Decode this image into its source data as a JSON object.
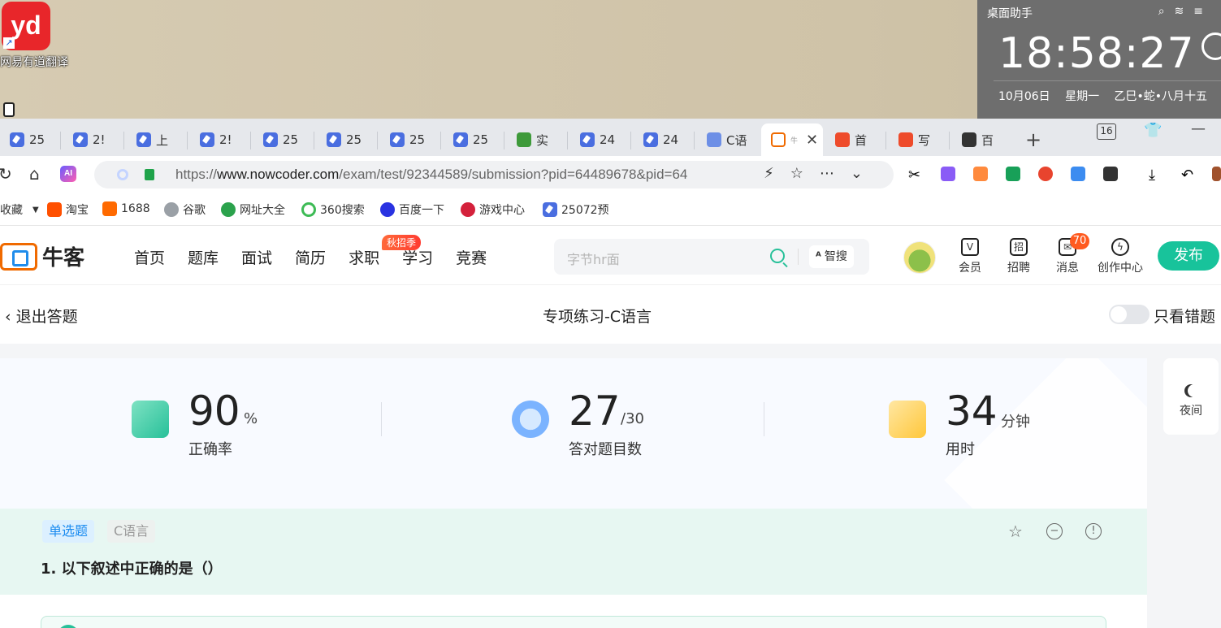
{
  "desktop": {
    "app_icon_text": "yd",
    "app_icon_label": "网易有道翻译",
    "widget": {
      "title": "桌面助手",
      "time": "18:58:27",
      "date": "10月06日",
      "weekday": "星期一",
      "lunar": "乙巳•蛇•八月十五"
    }
  },
  "browser": {
    "tabs": [
      {
        "label": "25",
        "icon": "pen-icon"
      },
      {
        "label": "2!",
        "icon": "pen-icon"
      },
      {
        "label": "上",
        "icon": "pen-icon"
      },
      {
        "label": "2!",
        "icon": "pen-icon"
      },
      {
        "label": "25",
        "icon": "pen-icon"
      },
      {
        "label": "25",
        "icon": "pen-icon"
      },
      {
        "label": "25",
        "icon": "pen-icon"
      },
      {
        "label": "25",
        "icon": "pen-icon"
      },
      {
        "label": "实",
        "icon": "green-icon"
      },
      {
        "label": "24",
        "icon": "pen-icon"
      },
      {
        "label": "24",
        "icon": "pen-icon"
      },
      {
        "label": "C语",
        "icon": "bird-icon"
      },
      {
        "label": "牛",
        "icon": "nowcoder-icon",
        "active": true
      },
      {
        "label": "首",
        "icon": "csdn-icon"
      },
      {
        "label": "写",
        "icon": "csdn-icon"
      },
      {
        "label": "百",
        "icon": "owl-icon"
      }
    ],
    "tab_count": "16",
    "url_prefix": "https://",
    "url_host": "www.nowcoder.com",
    "url_path": "/exam/test/92344589/submission?pid=64489678&pid=64",
    "ai_label": "AI",
    "bookmarks": [
      "收藏",
      "淘宝",
      "1688",
      "谷歌",
      "网址大全",
      "360搜索",
      "百度一下",
      "游戏中心",
      "25072预"
    ]
  },
  "site": {
    "logo_text": "牛客",
    "nav": [
      "首页",
      "题库",
      "面试",
      "简历",
      "求职",
      "学习",
      "竞赛"
    ],
    "nav_badge": "秋招季",
    "search_placeholder": "字节hr面",
    "zhisou_label": "智搜",
    "header_items": [
      {
        "label": "会员"
      },
      {
        "label": "招聘",
        "glyph": "招"
      },
      {
        "label": "消息"
      },
      {
        "label": "创作中心"
      }
    ],
    "message_count": "70",
    "publish_label": "发布"
  },
  "exam": {
    "exit_label": "退出答题",
    "title": "专项练习-C语言",
    "wrong_only_label": "只看错题",
    "stats": [
      {
        "value": "90",
        "unit": "%",
        "label": "正确率"
      },
      {
        "value": "27",
        "unit": "/30",
        "label": "答对题目数"
      },
      {
        "value": "34",
        "unit": "分钟",
        "label": "用时"
      }
    ],
    "night_label": "夜间",
    "question": {
      "type_tag": "单选题",
      "lang_tag": "C语言",
      "number": "1.",
      "text": "以下叙述中正确的是（）"
    }
  }
}
